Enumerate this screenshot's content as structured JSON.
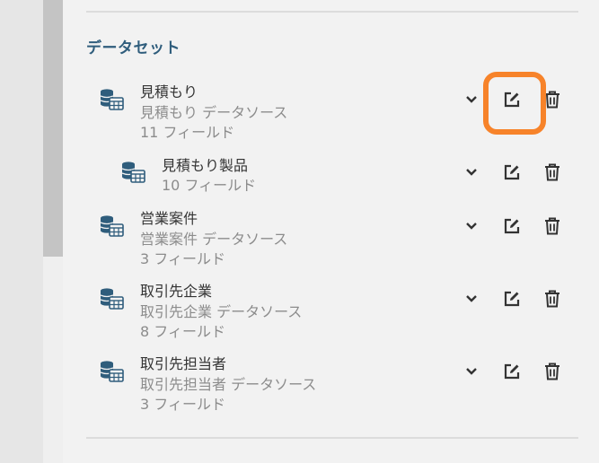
{
  "section": {
    "title": "データセット"
  },
  "datasets": [
    {
      "name": "見積もり",
      "source": "見積もり データソース",
      "fields": "11 フィールド"
    },
    {
      "name": "見積もり製品",
      "source": "",
      "fields": "10 フィールド"
    },
    {
      "name": "営業案件",
      "source": "営業案件 データソース",
      "fields": "3 フィールド"
    },
    {
      "name": "取引先企業",
      "source": "取引先企業 データソース",
      "fields": "8 フィールド"
    },
    {
      "name": "取引先担当者",
      "source": "取引先担当者 データソース",
      "fields": "3 フィールド"
    }
  ],
  "icons": {
    "dataset": "database-table-icon",
    "expand": "chevron-down-icon",
    "edit": "edit-icon",
    "delete": "trash-icon"
  },
  "colors": {
    "section_title": "#2f5d7c",
    "icon_blue": "#2f5d7c",
    "highlight": "#f7832a"
  }
}
